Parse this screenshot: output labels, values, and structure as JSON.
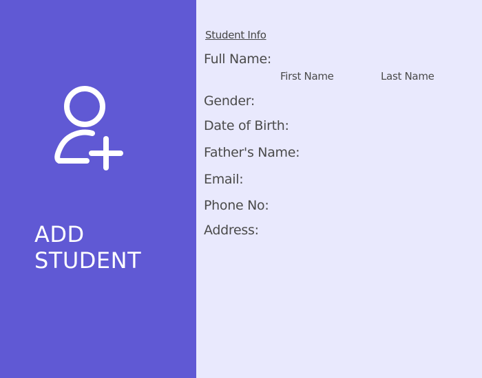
{
  "left_panel": {
    "icon": "add-user-icon",
    "title_line1": "ADD",
    "title_line2": "STUDENT",
    "background": "#6059d4"
  },
  "form": {
    "section_title": "Student Info",
    "full_name_label": "Full Name:",
    "first_name_label": "First Name",
    "last_name_label": "Last Name",
    "gender_label": "Gender:",
    "dob_label": "Date of Birth:",
    "father_name_label": "Father's Name:",
    "email_label": "Email:",
    "phone_label": "Phone No:",
    "address_label": "Address:"
  }
}
